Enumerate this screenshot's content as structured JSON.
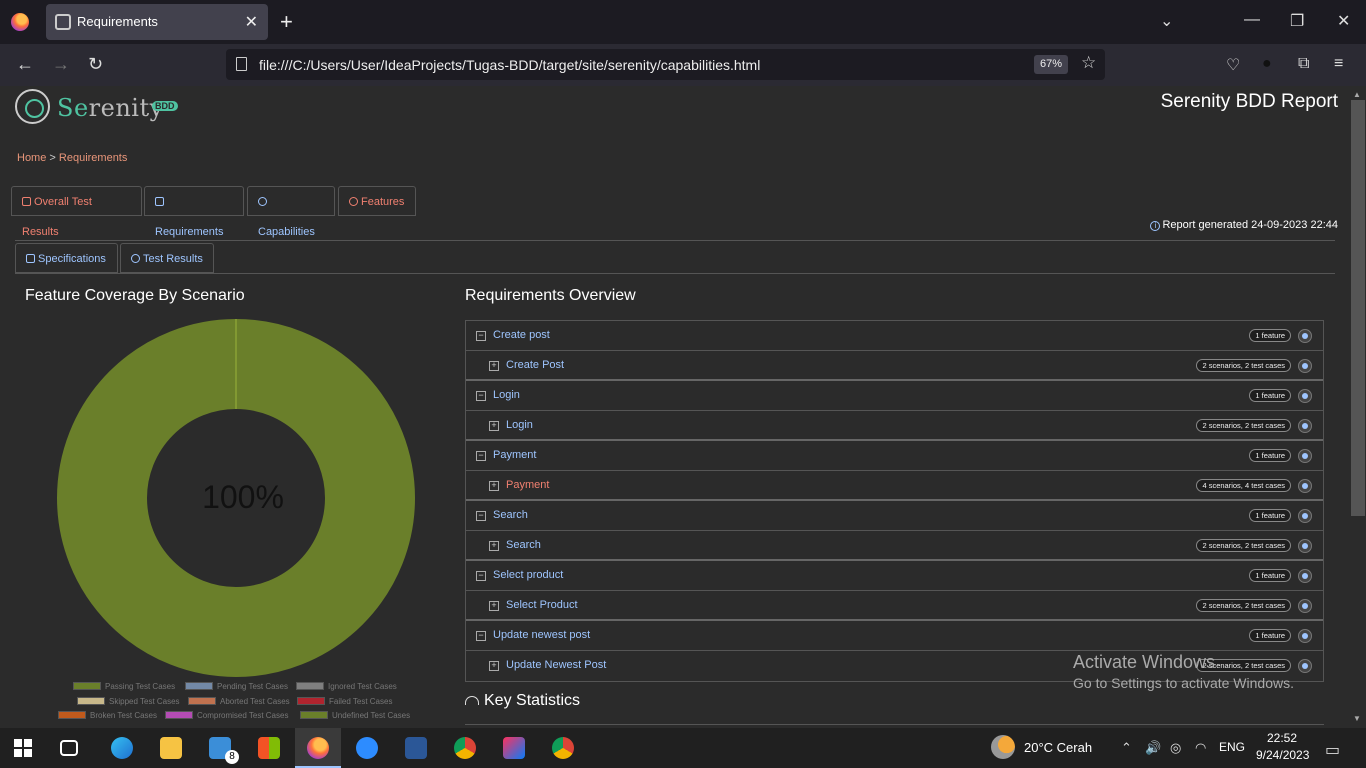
{
  "browser": {
    "tab_title": "Requirements",
    "url": "file:///C:/Users/User/IdeaProjects/Tugas-BDD/target/site/serenity/capabilities.html",
    "zoom": "67%"
  },
  "header": {
    "logo_text_s": "Se",
    "logo_text_rest": "renity",
    "logo_badge": "BDD",
    "report_title": "Serenity BDD Report"
  },
  "breadcrumb": {
    "home": "Home",
    "sep": " > ",
    "current": "Requirements"
  },
  "main_tabs": [
    {
      "label": "Overall Test Results"
    },
    {
      "label": "Requirements"
    },
    {
      "label": "Capabilities"
    },
    {
      "label": "Features"
    }
  ],
  "generated": "Report generated 24-09-2023 22:44",
  "sub_tabs": [
    {
      "label": "Specifications"
    },
    {
      "label": "Test Results"
    }
  ],
  "coverage": {
    "title": "Feature Coverage By Scenario",
    "center_label": "100%"
  },
  "chart_data": {
    "type": "pie",
    "title": "Feature Coverage By Scenario",
    "categories": [
      "Passing Test Cases",
      "Pending Test Cases",
      "Ignored Test Cases",
      "Skipped Test Cases",
      "Aborted Test Cases",
      "Failed Test Cases",
      "Broken Test Cases",
      "Compromised Test Cases",
      "Undefined Test Cases"
    ],
    "values": [
      100,
      0,
      0,
      0,
      0,
      0,
      0,
      0,
      0
    ],
    "colors": [
      "#6a7f2a",
      "#7389a6",
      "#7f7f7f",
      "#c8b88a",
      "#c0724f",
      "#b0242e",
      "#c05a1c",
      "#b44cb4",
      "#6a7f2a"
    ],
    "legend_position": "bottom"
  },
  "legend": [
    {
      "label": "Passing Test Cases",
      "color": "#6a7f2a"
    },
    {
      "label": "Pending Test Cases",
      "color": "#7389a6"
    },
    {
      "label": "Ignored Test Cases",
      "color": "#7f7f7f"
    },
    {
      "label": "Skipped Test Cases",
      "color": "#c8b88a"
    },
    {
      "label": "Aborted Test Cases",
      "color": "#c0724f"
    },
    {
      "label": "Failed Test Cases",
      "color": "#b0242e"
    },
    {
      "label": "Broken Test Cases",
      "color": "#c05a1c"
    },
    {
      "label": "Compromised Test Cases",
      "color": "#b44cb4"
    },
    {
      "label": "Undefined Test Cases",
      "color": "#6a7f2a"
    }
  ],
  "requirements": {
    "title": "Requirements Overview",
    "rows": [
      {
        "label": "Create post",
        "badge": "1 feature",
        "child": false
      },
      {
        "label": "Create Post",
        "badge": "2 scenarios, 2 test cases",
        "child": true
      },
      {
        "label": "Login",
        "badge": "1 feature",
        "child": false
      },
      {
        "label": "Login",
        "badge": "2 scenarios, 2 test cases",
        "child": true
      },
      {
        "label": "Payment",
        "badge": "1 feature",
        "child": false
      },
      {
        "label": "Payment",
        "badge": "4 scenarios, 4 test cases",
        "child": true,
        "red": true
      },
      {
        "label": "Search",
        "badge": "1 feature",
        "child": false
      },
      {
        "label": "Search",
        "badge": "2 scenarios, 2 test cases",
        "child": true
      },
      {
        "label": "Select product",
        "badge": "1 feature",
        "child": false
      },
      {
        "label": "Select Product",
        "badge": "2 scenarios, 2 test cases",
        "child": true
      },
      {
        "label": "Update newest post",
        "badge": "1 feature",
        "child": false
      },
      {
        "label": "Update Newest Post",
        "badge": "2 scenarios, 2 test cases",
        "child": true
      }
    ]
  },
  "key_statistics": "Key Statistics",
  "activate": {
    "line1": "Activate Windows",
    "line2": "Go to Settings to activate Windows."
  },
  "taskbar": {
    "weather": "20°C  Cerah",
    "lang": "ENG",
    "time": "22:52",
    "date": "9/24/2023",
    "mail_badge": "8"
  }
}
